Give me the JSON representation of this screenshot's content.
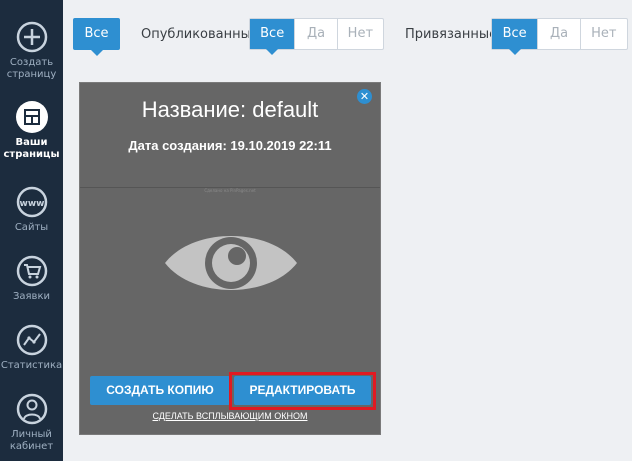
{
  "sidebar": {
    "items": [
      {
        "label_1": "Создать",
        "label_2": "страницу",
        "icon": "plus-circle-icon"
      },
      {
        "label_1": "Ваши",
        "label_2": "страницы",
        "icon": "pages-icon",
        "active": true
      },
      {
        "label_1": "Сайты",
        "label_2": "",
        "icon": "www-icon"
      },
      {
        "label_1": "Заявки",
        "label_2": "",
        "icon": "cart-icon"
      },
      {
        "label_1": "Статистика",
        "label_2": "",
        "icon": "stats-icon"
      },
      {
        "label_1": "Личный",
        "label_2": "кабинет",
        "icon": "user-icon"
      }
    ]
  },
  "filters": {
    "all_label": "Все",
    "published": {
      "label": "Опубликованные",
      "options": [
        "Все",
        "Да",
        "Нет"
      ],
      "selected": "Все"
    },
    "linked": {
      "label": "Привязанные",
      "options": [
        "Все",
        "Да",
        "Нет"
      ],
      "selected": "Все"
    }
  },
  "card": {
    "title": "Название: default",
    "date": "Дата создания: 19.10.2019 22:11",
    "preview_text": "Сделано на PinPages.net",
    "copy_button": "СОЗДАТЬ КОПИЮ",
    "edit_button": "РЕДАКТИРОВАТЬ",
    "popup_link": "СДЕЛАТЬ ВСПЛЫВАЮЩИМ ОКНОМ",
    "close_symbol": "✕"
  },
  "colors": {
    "accent": "#2e8fd1",
    "sidebar": "#1c2c3e",
    "highlight": "#e01a22",
    "card": "#666666"
  }
}
